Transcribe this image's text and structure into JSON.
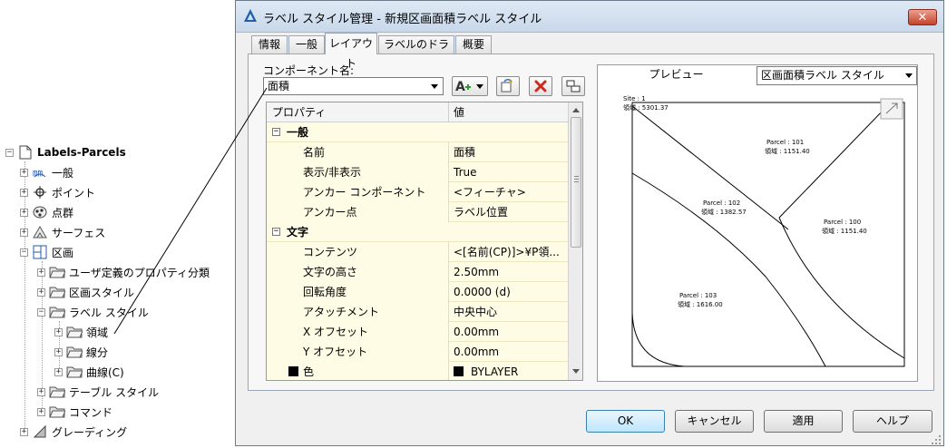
{
  "tree": {
    "root": "Labels-Parcels",
    "items": [
      {
        "label": "一般",
        "icon": "general-styles-icon"
      },
      {
        "label": "ポイント",
        "icon": "point-icon"
      },
      {
        "label": "点群",
        "icon": "point-group-icon"
      },
      {
        "label": "サーフェス",
        "icon": "surface-icon"
      },
      {
        "label": "区画",
        "icon": "parcel-icon"
      },
      {
        "label": "ユーザ定義のプロパティ分類",
        "icon": "folder-icon"
      },
      {
        "label": "区画スタイル",
        "icon": "folder-icon"
      },
      {
        "label": "ラベル スタイル",
        "icon": "folder-icon"
      },
      {
        "label": "領域",
        "icon": "folder-icon"
      },
      {
        "label": "線分",
        "icon": "folder-icon"
      },
      {
        "label": "曲線(C)",
        "icon": "folder-icon"
      },
      {
        "label": "テーブル スタイル",
        "icon": "folder-icon"
      },
      {
        "label": "コマンド",
        "icon": "folder-icon"
      },
      {
        "label": "グレーディング",
        "icon": "grading-icon"
      }
    ]
  },
  "dialog": {
    "title": "ラベル スタイル管理 - 新規区画面積ラベル スタイル",
    "close_glyph": "✕",
    "tabs": [
      "情報",
      "一般",
      "レイアウト",
      "ラベルのドラッグ",
      "概要"
    ],
    "active_tab": 2,
    "component_label": "コンポーネント名:",
    "component_value": "面積",
    "grid": {
      "col_property": "プロパティ",
      "col_value": "値",
      "rows": [
        {
          "type": "category",
          "label": "一般",
          "value": ""
        },
        {
          "type": "prop",
          "label": "名前",
          "value": "面積"
        },
        {
          "type": "prop",
          "label": "表示/非表示",
          "value": "True"
        },
        {
          "type": "prop",
          "label": "アンカー コンポーネント",
          "value": "<フィーチャ>"
        },
        {
          "type": "prop",
          "label": "アンカー点",
          "value": "ラベル位置"
        },
        {
          "type": "category",
          "label": "文字",
          "value": ""
        },
        {
          "type": "prop",
          "label": "コンテンツ",
          "value": "<[名前(CP)]>¥P領..."
        },
        {
          "type": "prop",
          "label": "文字の高さ",
          "value": "2.50mm"
        },
        {
          "type": "prop",
          "label": "回転角度",
          "value": "0.0000 (d)"
        },
        {
          "type": "prop",
          "label": "アタッチメント",
          "value": "中央中心"
        },
        {
          "type": "prop",
          "label": "X オフセット",
          "value": "0.00mm"
        },
        {
          "type": "prop",
          "label": "Y オフセット",
          "value": "0.00mm"
        },
        {
          "type": "color",
          "label": "色",
          "value": "BYLAYER"
        }
      ]
    },
    "preview": {
      "label": "プレビュー",
      "select_value": "区画面積ラベル スタイル",
      "labels": [
        {
          "name": "Site : 1",
          "area": "領域 : 5301.37"
        },
        {
          "name": "Parcel : 101",
          "area": "領域 : 1151.40"
        },
        {
          "name": "Parcel : 102",
          "area": "領域 : 1382.57"
        },
        {
          "name": "Parcel : 100",
          "area": "領域 : 1151.40"
        },
        {
          "name": "Parcel : 103",
          "area": "領域 : 1616.00"
        }
      ]
    },
    "buttons": {
      "ok": "OK",
      "cancel": "キャンセル",
      "apply": "適用",
      "help": "ヘルプ"
    }
  }
}
